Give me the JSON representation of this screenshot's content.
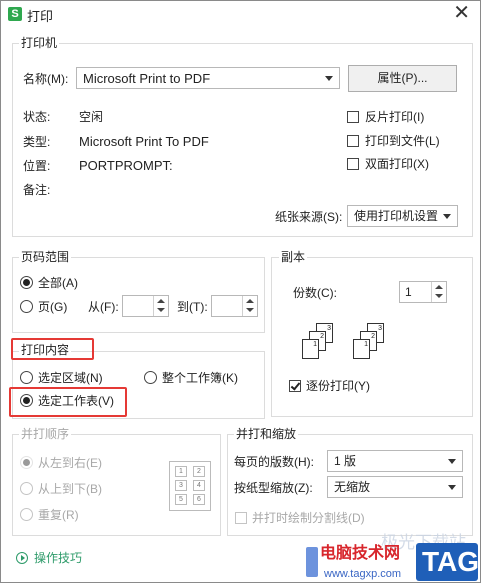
{
  "window": {
    "title": "打印",
    "app_icon_letter": "S"
  },
  "printer_group": {
    "label": "打印机",
    "name_label": "名称(M):",
    "name_value": "Microsoft Print to PDF",
    "properties_button": "属性(P)...",
    "status_label": "状态:",
    "status_value": "空闲",
    "type_label": "类型:",
    "type_value": "Microsoft Print To PDF",
    "location_label": "位置:",
    "location_value": "PORTPROMPT:",
    "comment_label": "备注:",
    "reverse_print": "反片打印(I)",
    "print_to_file": "打印到文件(L)",
    "duplex_print": "双面打印(X)",
    "paper_source_label": "纸张来源(S):",
    "paper_source_value": "使用打印机设置"
  },
  "page_range": {
    "label": "页码范围",
    "all": "全部(A)",
    "pages": "页(G)",
    "from_label": "从(F):",
    "to_label": "到(T):"
  },
  "copies": {
    "label": "副本",
    "count_label": "份数(C):",
    "count_value": "1",
    "collate": "逐份打印(Y)",
    "stack_a": [
      "1",
      "2",
      "3"
    ],
    "stack_b": [
      "1",
      "2",
      "3"
    ]
  },
  "print_content": {
    "label": "打印内容",
    "selection": "选定区域(N)",
    "whole_workbook": "整个工作簿(K)",
    "selected_sheets": "选定工作表(V)"
  },
  "collate_order": {
    "label": "并打顺序",
    "left_to_right": "从左到右(E)",
    "top_to_bottom": "从上到下(B)",
    "repeat": "重复(R)",
    "grid": [
      "1",
      "2",
      "3",
      "4",
      "5",
      "6"
    ]
  },
  "zoom": {
    "label": "并打和缩放",
    "pages_per_sheet_label": "每页的版数(H):",
    "pages_per_sheet_value": "1 版",
    "scale_label": "按纸型缩放(Z):",
    "scale_value": "无缩放",
    "draw_divider": "并打时绘制分割线(D)"
  },
  "footer": {
    "tips": "操作技巧"
  },
  "watermark": {
    "text_cn": "电脑技术网",
    "url": "www.tagxp.com",
    "tag": "TAG",
    "faint": "极光下载站"
  },
  "colors": {
    "highlight_red": "#e53935",
    "tag_blue": "#1f5fb8",
    "watermark_red": "#d8262c",
    "tips_green": "#2e9b6a"
  }
}
